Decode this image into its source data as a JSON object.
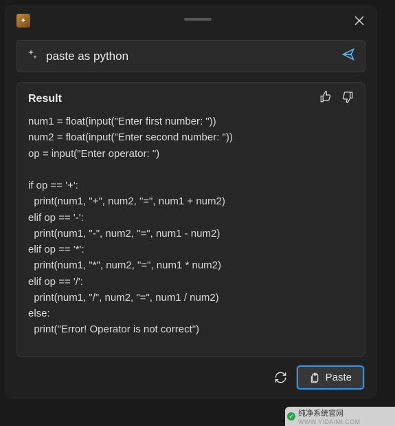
{
  "prompt": {
    "value": "paste as python"
  },
  "result": {
    "title": "Result",
    "code": "num1 = float(input(\"Enter first number: \"))\nnum2 = float(input(\"Enter second number: \"))\nop = input(\"Enter operator: \")\n\nif op == '+':\n  print(num1, \"+\", num2, \"=\", num1 + num2)\nelif op == '-':\n  print(num1, \"-\", num2, \"=\", num1 - num2)\nelif op == '*':\n  print(num1, \"*\", num2, \"=\", num1 * num2)\nelif op == '/':\n  print(num1, \"/\", num2, \"=\", num1 / num2)\nelse:\n  print(\"Error! Operator is not correct\")"
  },
  "actions": {
    "paste_label": "Paste"
  },
  "watermark": {
    "text": "纯净系统官网",
    "url": "WWW.YIDAIMI.COM"
  }
}
